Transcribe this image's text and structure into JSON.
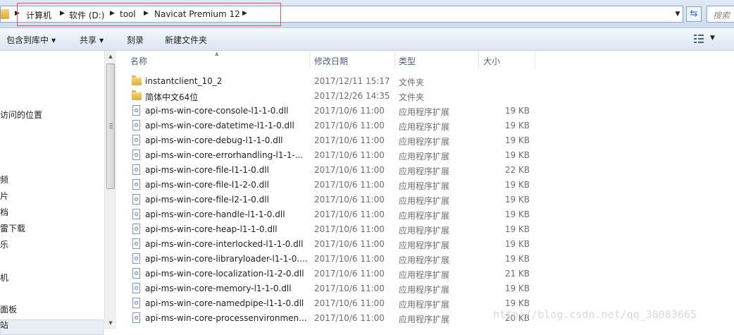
{
  "address": {
    "crumbs": [
      "计算机",
      "软件 (D:)",
      "tool",
      "Navicat Premium 12"
    ],
    "search_placeholder": "搜索"
  },
  "toolbar": {
    "include_library": "包含到库中",
    "share": "共享",
    "burn": "刻录",
    "new_folder": "新建文件夹"
  },
  "nav": {
    "items": [
      "访问的位置",
      "频",
      "片",
      "档",
      "雷下载",
      "乐",
      "机",
      "面板",
      "站"
    ]
  },
  "columns": {
    "name": "名称",
    "date": "修改日期",
    "type": "类型",
    "size": "大小"
  },
  "files": [
    {
      "name": "instantclient_10_2",
      "date": "2017/12/11 15:17",
      "type": "文件夹",
      "size": "",
      "kind": "folder"
    },
    {
      "name": "简体中文64位",
      "date": "2017/12/26 14:35",
      "type": "文件夹",
      "size": "",
      "kind": "folder"
    },
    {
      "name": "api-ms-win-core-console-l1-1-0.dll",
      "date": "2017/10/6 11:00",
      "type": "应用程序扩展",
      "size": "19 KB",
      "kind": "dll"
    },
    {
      "name": "api-ms-win-core-datetime-l1-1-0.dll",
      "date": "2017/10/6 11:00",
      "type": "应用程序扩展",
      "size": "19 KB",
      "kind": "dll"
    },
    {
      "name": "api-ms-win-core-debug-l1-1-0.dll",
      "date": "2017/10/6 11:00",
      "type": "应用程序扩展",
      "size": "19 KB",
      "kind": "dll"
    },
    {
      "name": "api-ms-win-core-errorhandling-l1-1-...",
      "date": "2017/10/6 11:00",
      "type": "应用程序扩展",
      "size": "19 KB",
      "kind": "dll"
    },
    {
      "name": "api-ms-win-core-file-l1-1-0.dll",
      "date": "2017/10/6 11:00",
      "type": "应用程序扩展",
      "size": "22 KB",
      "kind": "dll"
    },
    {
      "name": "api-ms-win-core-file-l1-2-0.dll",
      "date": "2017/10/6 11:00",
      "type": "应用程序扩展",
      "size": "19 KB",
      "kind": "dll"
    },
    {
      "name": "api-ms-win-core-file-l2-1-0.dll",
      "date": "2017/10/6 11:00",
      "type": "应用程序扩展",
      "size": "19 KB",
      "kind": "dll"
    },
    {
      "name": "api-ms-win-core-handle-l1-1-0.dll",
      "date": "2017/10/6 11:00",
      "type": "应用程序扩展",
      "size": "19 KB",
      "kind": "dll"
    },
    {
      "name": "api-ms-win-core-heap-l1-1-0.dll",
      "date": "2017/10/6 11:00",
      "type": "应用程序扩展",
      "size": "19 KB",
      "kind": "dll"
    },
    {
      "name": "api-ms-win-core-interlocked-l1-1-0.dll",
      "date": "2017/10/6 11:00",
      "type": "应用程序扩展",
      "size": "19 KB",
      "kind": "dll"
    },
    {
      "name": "api-ms-win-core-libraryloader-l1-1-0....",
      "date": "2017/10/6 11:00",
      "type": "应用程序扩展",
      "size": "19 KB",
      "kind": "dll"
    },
    {
      "name": "api-ms-win-core-localization-l1-2-0.dll",
      "date": "2017/10/6 11:00",
      "type": "应用程序扩展",
      "size": "21 KB",
      "kind": "dll"
    },
    {
      "name": "api-ms-win-core-memory-l1-1-0.dll",
      "date": "2017/10/6 11:00",
      "type": "应用程序扩展",
      "size": "19 KB",
      "kind": "dll"
    },
    {
      "name": "api-ms-win-core-namedpipe-l1-1-0.dll",
      "date": "2017/10/6 11:00",
      "type": "应用程序扩展",
      "size": "19 KB",
      "kind": "dll"
    },
    {
      "name": "api-ms-win-core-processenvironmen...",
      "date": "2017/10/6 11:00",
      "type": "应用程序扩展",
      "size": "20 KB",
      "kind": "dll"
    }
  ],
  "watermark": "http://blog.csdn.net/qq_38083665"
}
